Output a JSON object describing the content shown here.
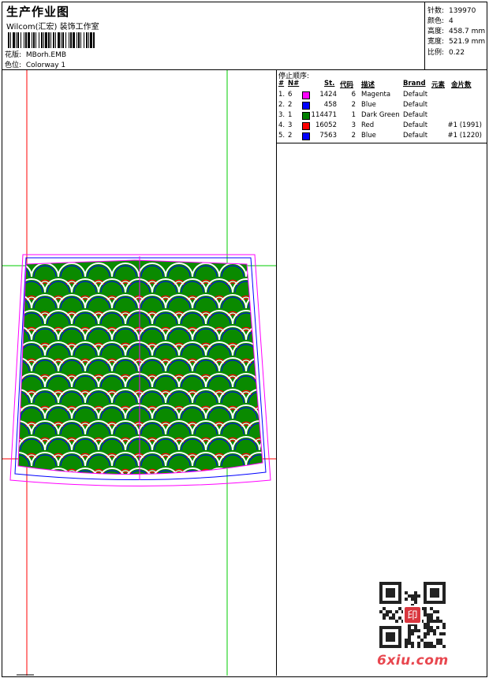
{
  "header": {
    "title": "生产作业图",
    "company": "Wilcom(汇宏) 装饰工作室",
    "pattern_label": "花版:",
    "pattern_value": "MBorh.EMB",
    "colorway_label": "色位:",
    "colorway_value": "Colorway 1"
  },
  "stats": [
    {
      "label": "针数:",
      "value": "139970"
    },
    {
      "label": "颜色:",
      "value": "4"
    },
    {
      "label": "高度:",
      "value": "458.7 mm"
    },
    {
      "label": "宽度:",
      "value": "521.9 mm"
    },
    {
      "label": "比例:",
      "value": "0.22"
    }
  ],
  "sequence": {
    "title": "停止顺序:",
    "headers": {
      "num": "#",
      "n": "N#",
      "st": "St.",
      "code": "代码",
      "desc": "描述",
      "brand": "Brand",
      "element": "元素",
      "sequin": "金片数"
    },
    "rows": [
      {
        "num": "1.",
        "n": "6",
        "color": "#ff00ff",
        "st": "1424",
        "code": "6",
        "desc": "Magenta",
        "brand": "Default",
        "sequin": ""
      },
      {
        "num": "2.",
        "n": "2",
        "color": "#0000ff",
        "st": "458",
        "code": "2",
        "desc": "Blue",
        "brand": "Default",
        "sequin": ""
      },
      {
        "num": "3.",
        "n": "1",
        "color": "#008000",
        "st": "114471",
        "code": "1",
        "desc": "Dark Green",
        "brand": "Default",
        "sequin": ""
      },
      {
        "num": "4.",
        "n": "3",
        "color": "#ff0000",
        "st": "16052",
        "code": "3",
        "desc": "Red",
        "brand": "Default",
        "sequin": "#1 (1991)"
      },
      {
        "num": "5.",
        "n": "2",
        "color": "#0000ff",
        "st": "7563",
        "code": "2",
        "desc": "Blue",
        "brand": "Default",
        "sequin": "#1 (1220)"
      }
    ]
  },
  "colors": {
    "green": "#0a8a00",
    "magenta": "#ff00ff",
    "blue": "#0000ff",
    "red": "#ff0000",
    "guide_red": "#ff0000",
    "guide_green": "#00cc00"
  },
  "watermark": {
    "text": "6xiu.com",
    "qr_stamp": "印"
  }
}
